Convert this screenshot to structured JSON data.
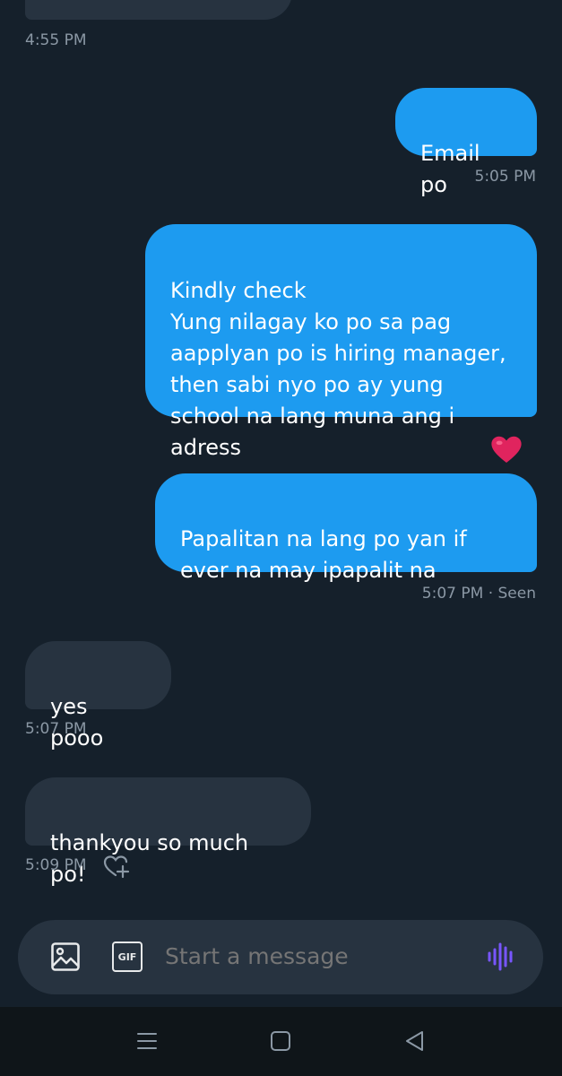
{
  "conversation": {
    "top_timestamp": "4:55 PM",
    "messages": [
      {
        "id": "m1",
        "direction": "sent",
        "text": "Email po",
        "time": "5:05 PM"
      },
      {
        "id": "m2",
        "direction": "sent",
        "text": "Kindly check\nYung nilagay ko po sa pag aapplyan po is hiring manager, then sabi nyo po ay yung school na lang muna ang i adress",
        "reaction": "red-heart"
      },
      {
        "id": "m3",
        "direction": "sent",
        "text": "Papalitan na lang po yan if ever na may ipapalit na",
        "time": "5:07 PM · Seen"
      },
      {
        "id": "m4",
        "direction": "received",
        "text": "yes pooo",
        "time": "5:07 PM"
      },
      {
        "id": "m5",
        "direction": "received",
        "text": "thankyou so much po!",
        "time": "5:09 PM"
      }
    ]
  },
  "composer": {
    "placeholder": "Start a message",
    "media_icon": "image-icon",
    "gif_icon": "gif-icon",
    "gif_label": "GIF",
    "voice_icon": "voice-waveform-icon"
  },
  "navbar": {
    "icons": [
      "menu-icon",
      "home-square-icon",
      "back-triangle-icon"
    ]
  },
  "colors": {
    "background": "#15202b",
    "sent_bubble": "#1d9bf0",
    "received_bubble": "#273340",
    "timestamp": "#8b98a5",
    "voice_accent": "#7856ff",
    "heart": "#e0245e"
  }
}
